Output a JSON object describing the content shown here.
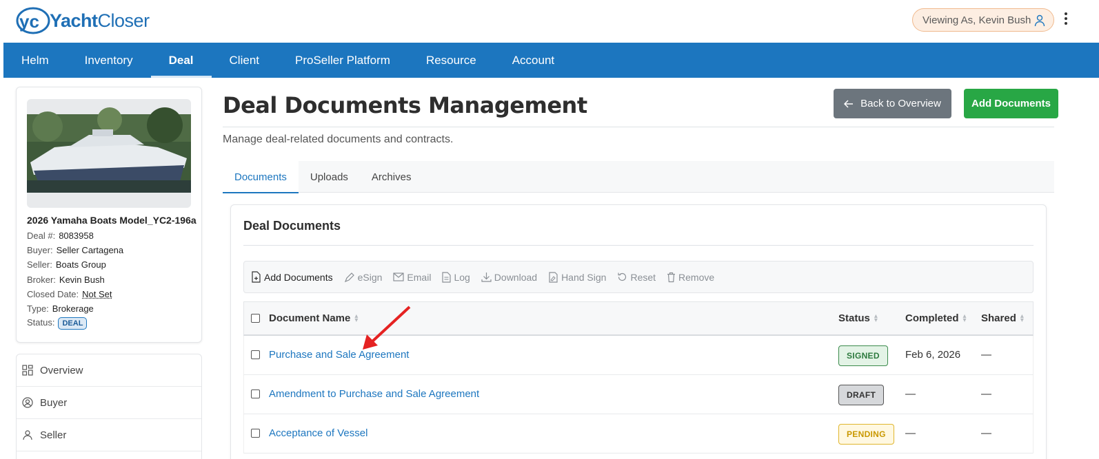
{
  "brand": {
    "logo_text_bold": "Yacht",
    "logo_text_light": "Closer",
    "accent": "#1c76bf"
  },
  "header": {
    "viewing_as": "Viewing As, Kevin Bush"
  },
  "nav": {
    "items": [
      {
        "label": "Helm"
      },
      {
        "label": "Inventory"
      },
      {
        "label": "Deal",
        "active": true
      },
      {
        "label": "Client"
      },
      {
        "label": "ProSeller Platform"
      },
      {
        "label": "Resource"
      },
      {
        "label": "Account"
      }
    ]
  },
  "deal": {
    "title": "2026 Yamaha Boats Model_YC2-196a",
    "deal_no_label": "Deal #:",
    "deal_no": "8083958",
    "buyer_label": "Buyer:",
    "buyer": "Seller Cartagena",
    "seller_label": "Seller:",
    "seller": "Boats Group",
    "broker_label": "Broker:",
    "broker": "Kevin Bush",
    "closed_label": "Closed Date:",
    "closed": "Not Set",
    "type_label": "Type:",
    "type": "Brokerage",
    "status_label": "Status:",
    "status": "DEAL"
  },
  "side_menu": {
    "items": [
      {
        "label": "Overview",
        "icon": "grid-icon"
      },
      {
        "label": "Buyer",
        "icon": "user-circle-icon"
      },
      {
        "label": "Seller",
        "icon": "user-icon"
      }
    ]
  },
  "page": {
    "title": "Deal Documents Management",
    "subtitle": "Manage deal-related documents and contracts.",
    "back_label": "Back to Overview",
    "add_label": "Add Documents"
  },
  "tabs": [
    {
      "label": "Documents",
      "active": true
    },
    {
      "label": "Uploads"
    },
    {
      "label": "Archives"
    }
  ],
  "panel": {
    "title": "Deal Documents",
    "toolbar": {
      "add": "Add Documents",
      "esign": "eSign",
      "email": "Email",
      "log": "Log",
      "download": "Download",
      "hand_sign": "Hand Sign",
      "reset": "Reset",
      "remove": "Remove"
    },
    "columns": {
      "name": "Document Name",
      "status": "Status",
      "completed": "Completed",
      "shared": "Shared"
    },
    "rows": [
      {
        "name": "Purchase and Sale Agreement",
        "status": "SIGNED",
        "completed": "Feb 6, 2026",
        "shared": "—"
      },
      {
        "name": "Amendment to Purchase and Sale Agreement",
        "status": "DRAFT",
        "completed": "—",
        "shared": "—"
      },
      {
        "name": "Acceptance of Vessel",
        "status": "PENDING",
        "completed": "—",
        "shared": "—"
      }
    ]
  }
}
